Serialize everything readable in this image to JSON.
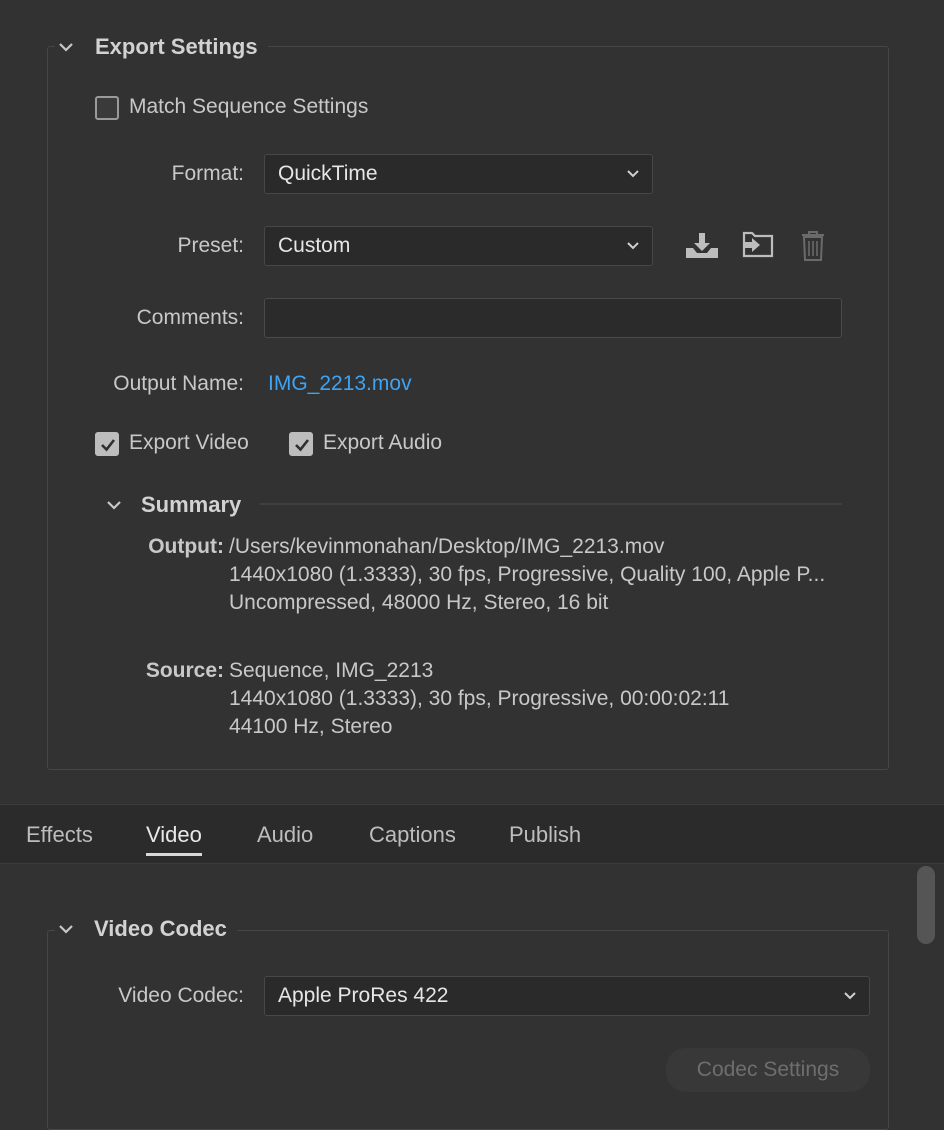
{
  "export_settings": {
    "title": "Export Settings",
    "match_sequence_label": "Match Sequence Settings",
    "format_label": "Format:",
    "format_value": "QuickTime",
    "preset_label": "Preset:",
    "preset_value": "Custom",
    "comments_label": "Comments:",
    "comments_value": "",
    "output_name_label": "Output Name:",
    "output_name_value": "IMG_2213.mov",
    "export_video_label": "Export Video",
    "export_audio_label": "Export Audio",
    "match_sequence_checked": false,
    "export_video_checked": true,
    "export_audio_checked": true
  },
  "summary": {
    "title": "Summary",
    "output_key": "Output:",
    "output_lines": [
      "/Users/kevinmonahan/Desktop/IMG_2213.mov",
      "1440x1080 (1.3333), 30 fps, Progressive, Quality 100, Apple P...",
      "Uncompressed, 48000 Hz, Stereo, 16 bit"
    ],
    "source_key": "Source:",
    "source_lines": [
      "Sequence, IMG_2213",
      "1440x1080 (1.3333), 30 fps, Progressive, 00:00:02:11",
      "44100 Hz, Stereo"
    ]
  },
  "tabs": [
    {
      "label": "Effects",
      "active": false
    },
    {
      "label": "Video",
      "active": true
    },
    {
      "label": "Audio",
      "active": false
    },
    {
      "label": "Captions",
      "active": false
    },
    {
      "label": "Publish",
      "active": false
    }
  ],
  "video_codec": {
    "title": "Video Codec",
    "codec_label": "Video Codec:",
    "codec_value": "Apple ProRes 422",
    "codec_settings_button": "Codec Settings"
  },
  "icons": {
    "save_preset": "download-tray-icon",
    "import_preset": "import-folder-icon",
    "delete_preset": "trash-icon"
  },
  "colors": {
    "background": "#323232",
    "link": "#3ea3f2",
    "text": "#c8c8c8"
  }
}
